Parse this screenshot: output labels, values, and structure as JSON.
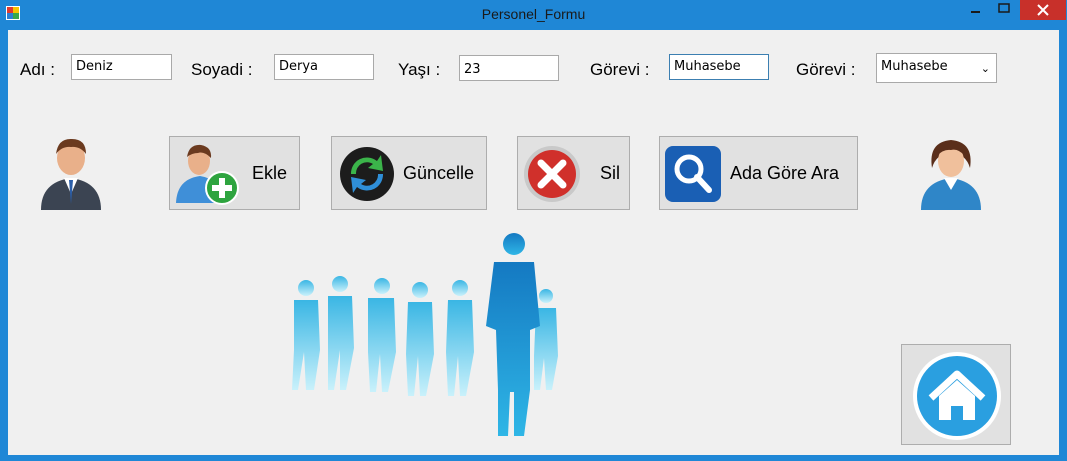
{
  "window": {
    "title": "Personel_Formu"
  },
  "form": {
    "name_label": "Adı :",
    "name_value": "Deniz",
    "surname_label": "Soyadi :",
    "surname_value": "Derya",
    "age_label": "Yaşı :",
    "age_value": "23",
    "role_label": "Görevi :",
    "role_value": "Muhasebe",
    "role2_label": "Görevi :",
    "role2_selected": "Muhasebe"
  },
  "buttons": {
    "add": "Ekle",
    "update": "Güncelle",
    "delete": "Sil",
    "search": "Ada Göre Ara"
  },
  "icons": {
    "app": "app-icon",
    "male_avatar": "male-user-icon",
    "female_avatar": "female-user-icon",
    "add": "add-user-icon",
    "update": "refresh-icon",
    "delete": "delete-icon",
    "search": "search-icon",
    "home": "home-icon",
    "people": "people-silhouette-icon"
  },
  "colors": {
    "titlebar": "#1f87d6",
    "close": "#c8302a",
    "client_bg": "#f0f0f0",
    "button_bg": "#e1e1e1"
  }
}
